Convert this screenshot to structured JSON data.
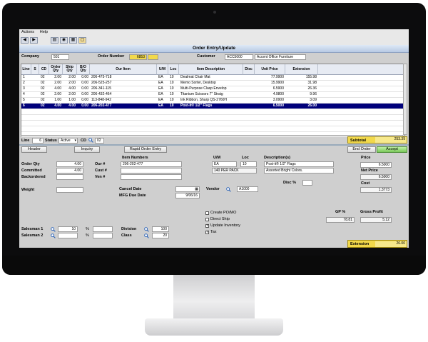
{
  "menu": [
    "Actions",
    "Help"
  ],
  "toolbar_icons": [
    "back-arrow-icon",
    "forward-arrow-icon",
    "cart-icon",
    "binoculars-icon",
    "calculator-icon",
    "folder-icon"
  ],
  "title": "Order Entry/Update",
  "header": {
    "company_label": "Company",
    "company": "501",
    "order_number_label": "Order Number",
    "order_number": "6853",
    "customer_label": "Customer",
    "customer_code": "ACC5000",
    "customer_name": "Accent Office Furniture"
  },
  "grid": {
    "columns": [
      "Line",
      "S",
      "CD",
      "Order Qty",
      "Ship Qty",
      "B/O Qty",
      "Our Item",
      "U/M",
      "Loc",
      "Item Description",
      "Disc",
      "Unit Price",
      "Extension"
    ],
    "rows": [
      [
        "1",
        "",
        "02",
        "2.00",
        "2.00",
        "0.00",
        "206-475-718",
        "EA",
        "10",
        "Dealmat Chair Mat",
        "",
        "77.9900",
        "155.98"
      ],
      [
        "2",
        "",
        "02",
        "2.00",
        "2.00",
        "0.00",
        "206-525-257",
        "EA",
        "10",
        "Memo Sorter, Desktop",
        "",
        "15.9900",
        "31.98"
      ],
      [
        "3",
        "",
        "02",
        "4.00",
        "4.00",
        "0.00",
        "206-341-115",
        "EA",
        "10",
        "Multi-Purpose Clasp Envelop",
        "",
        "6.5900",
        "26.36"
      ],
      [
        "4",
        "",
        "02",
        "2.00",
        "2.00",
        "0.00",
        "206-432-464",
        "EA",
        "10",
        "Titanium Scissors 7\" Straig",
        "",
        "4.9800",
        "9.96"
      ],
      [
        "5",
        "",
        "02",
        "1.00",
        "1.00",
        "0.00",
        "113-848-942",
        "EA",
        "10",
        "Ink Ribbon, Sharp QS-2760H",
        "",
        "3.0900",
        "3.09"
      ],
      [
        "6",
        "",
        "02",
        "4.00",
        "4.00",
        "0.00",
        "206-202-477",
        "EA",
        "10",
        "Post-it® 1/2\" Flags",
        "",
        "6.5000",
        "26.00"
      ]
    ],
    "selected_row": 5
  },
  "status": {
    "line_label": "Line",
    "line": "6",
    "status_label": "Status",
    "status": "Active",
    "cd_label": "CD",
    "cd": "02",
    "subtotal_label": "Subtotal",
    "subtotal": "253.39"
  },
  "buttons": {
    "header": "Header",
    "inquiry": "Inquiry",
    "rapid": "Rapid Order Entry",
    "end_order": "End Order",
    "accept": "Accept"
  },
  "detail": {
    "order_qty_label": "Order Qty",
    "order_qty": "4.00",
    "committed_label": "Committed",
    "committed": "4.00",
    "backordered_label": "Backordered",
    "weight_label": "Weight",
    "item_numbers_label": "Item Numbers",
    "our_label": "Our #",
    "our": "206-202-477",
    "cust_label": "Cust #",
    "ven_label": "Ven #",
    "um_label": "U/M",
    "um": "EA",
    "um_desc": "140 PER PACK",
    "loc_label": "Loc",
    "loc": "10",
    "descriptions_label": "Description(s)",
    "desc1": "Post-it® 1/2\" Flags",
    "desc2": "Assorted Bright Colors.",
    "disc_label": "Disc %",
    "price_label": "Price",
    "price": "6.5000",
    "net_price_label": "Net Price",
    "net_price": "6.5000",
    "cost_label": "Cost",
    "cost": "1.3773",
    "cancel_date_label": "Cancel Date",
    "mfg_due_label": "MFG Due Date",
    "mfg_due": "9/06/16",
    "vendor_label": "Vendor",
    "vendor": "A1000",
    "create_po": "Create PO/MO",
    "direct_ship": "Direct Ship",
    "update_inventory": "Update Inventory",
    "tax": "Tax",
    "gp_label": "GP %",
    "gp": "78.81",
    "gross_profit_label": "Gross Profit",
    "gross_profit": "5.12",
    "salesman1_label": "Salesman 1",
    "salesman1": "10",
    "salesman2_label": "Salesman 2",
    "pct": "%",
    "division_label": "Division",
    "division": "100",
    "class_label": "Class",
    "class": "20",
    "extension_label": "Extension",
    "extension": "26.00"
  }
}
